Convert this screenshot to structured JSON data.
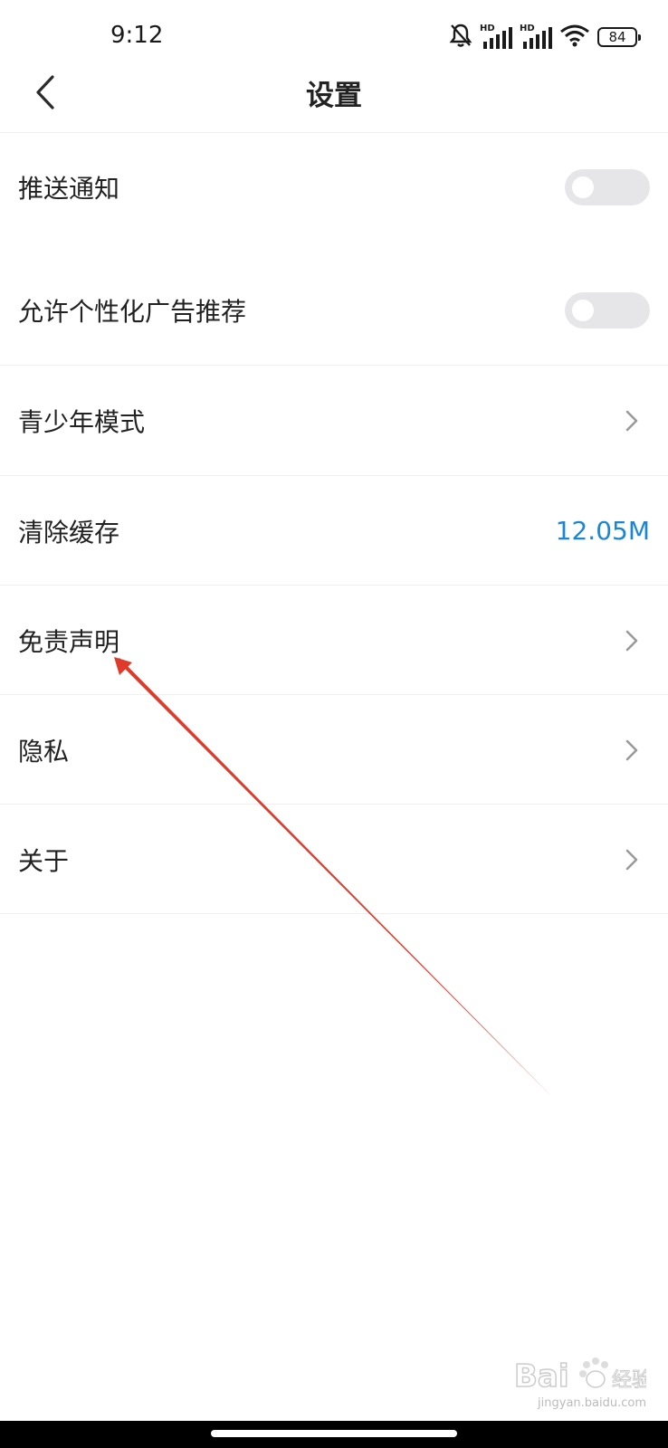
{
  "status_bar": {
    "time": "9:12",
    "battery": "84",
    "hd_label_1": "HD",
    "hd_label_2": "HD"
  },
  "header": {
    "title": "设置"
  },
  "settings": {
    "push_notifications": {
      "label": "推送通知",
      "enabled": false
    },
    "personalized_ads": {
      "label": "允许个性化广告推荐",
      "enabled": false
    },
    "teen_mode": {
      "label": "青少年模式"
    },
    "clear_cache": {
      "label": "清除缓存",
      "value": "12.05M"
    },
    "disclaimer": {
      "label": "免责声明"
    },
    "privacy": {
      "label": "隐私"
    },
    "about": {
      "label": "关于"
    }
  },
  "watermark": {
    "site": "jingyan.baidu.com"
  },
  "colors": {
    "accent": "#1a86d4",
    "arrow": "#e03a2a",
    "toggle_off": "#e6e6e9",
    "text": "#222222"
  }
}
